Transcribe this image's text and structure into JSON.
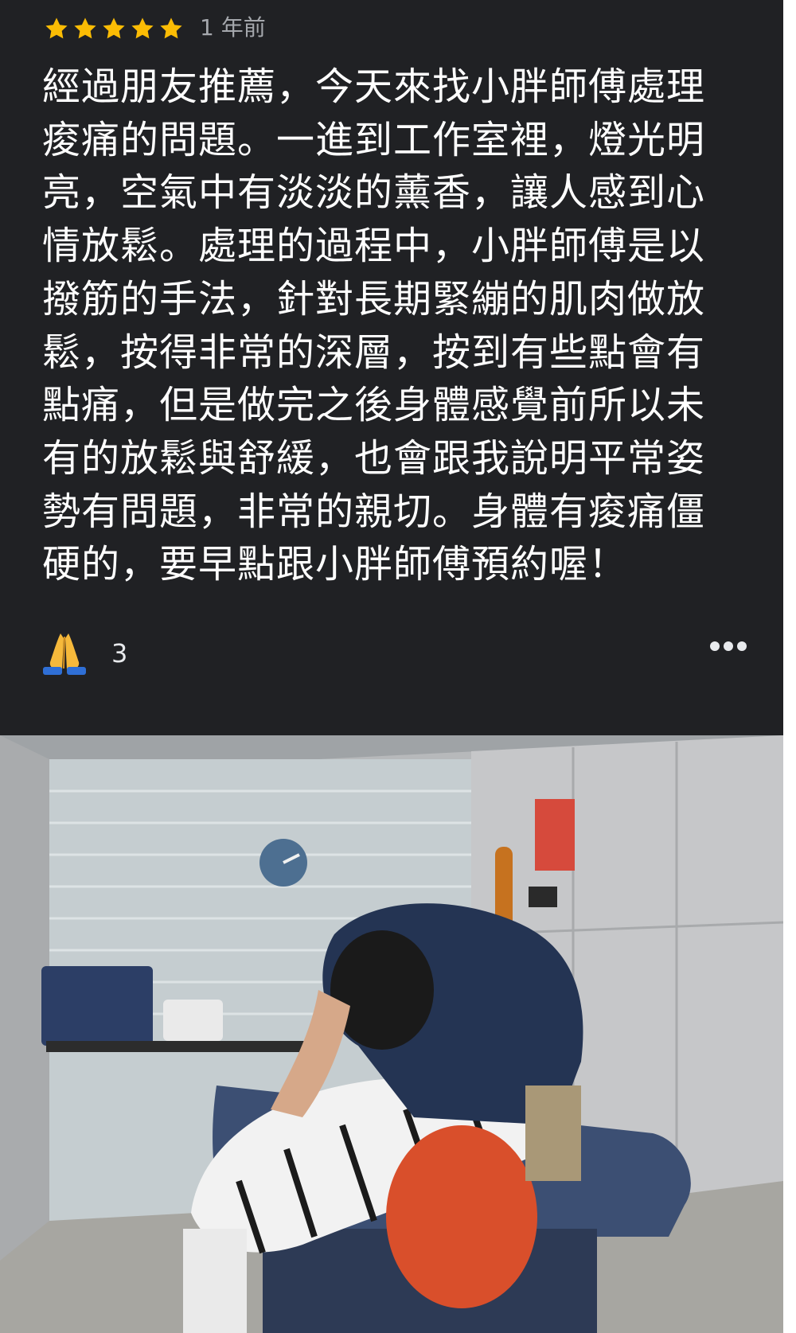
{
  "review": {
    "rating": 5,
    "time": "1 年前",
    "lines": [
      "經過朋友推薦，今天來找小胖師傅處理",
      "痠痛的問題。一進到工作室裡，燈光明",
      "亮，空氣中有淡淡的薰香，讓人感到心",
      "情放鬆。處理的過程中，小胖師傅是以",
      "撥筋的手法，針對長期緊繃的肌肉做放",
      "鬆，按得非常的深層，按到有些點會有",
      "點痛，但是做完之後身體感覺前所以未",
      "有的放鬆與舒緩，也會跟我說明平常姿",
      "勢有問題，非常的親切。身體有痠痛僵",
      "硬的，要早點跟小胖師傅預約喔！"
    ],
    "reaction_icon": "folded-hands-icon",
    "reaction_count": "3",
    "more_icon": "more-dots-icon"
  },
  "colors": {
    "card_background": "#202124",
    "star": "#fbbc04",
    "secondary_text": "#a5a8ad"
  }
}
